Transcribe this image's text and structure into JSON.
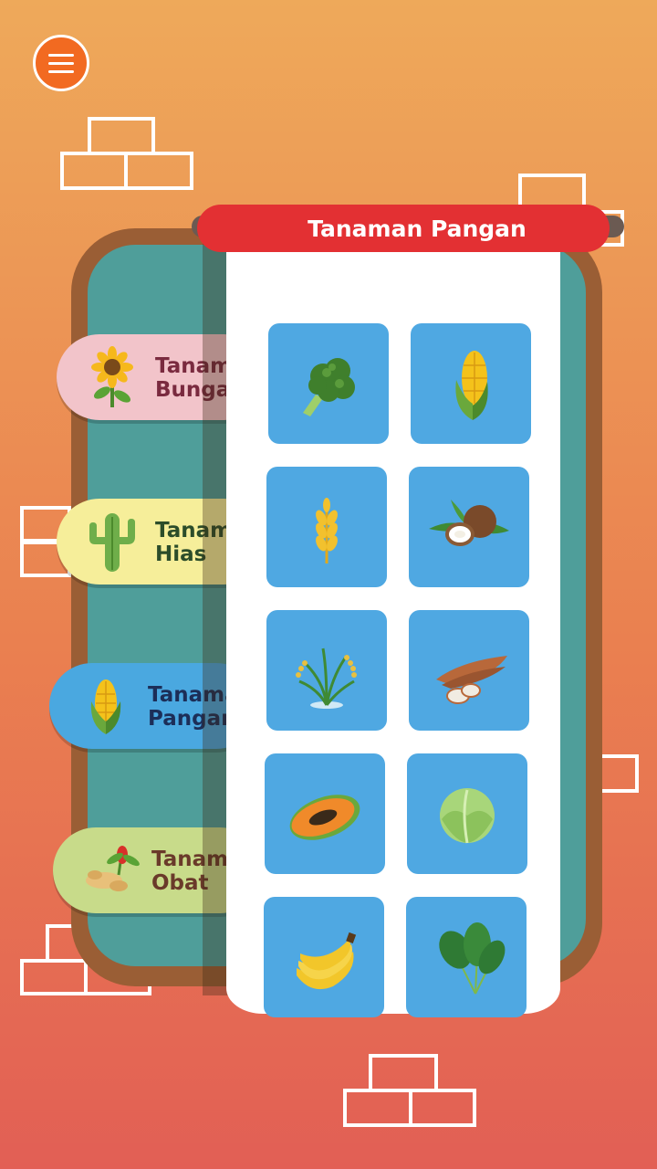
{
  "header": {
    "menu_icon": "hamburger-menu-icon"
  },
  "panel": {
    "title": "Tanaman Pangan"
  },
  "categories": [
    {
      "label": "Tanaman\nBunga",
      "icon": "sunflower-icon"
    },
    {
      "label": "Tanaman\nHias",
      "icon": "cactus-icon"
    },
    {
      "label": "Tanaman\nPangan",
      "icon": "corn-icon"
    },
    {
      "label": "Tanaman\nObat",
      "icon": "ginger-icon"
    }
  ],
  "items": [
    {
      "icon": "broccoli-icon"
    },
    {
      "icon": "corn-icon"
    },
    {
      "icon": "wheat-icon"
    },
    {
      "icon": "coconut-icon"
    },
    {
      "icon": "rice-plant-icon"
    },
    {
      "icon": "cassava-icon"
    },
    {
      "icon": "papaya-icon"
    },
    {
      "icon": "cabbage-icon"
    },
    {
      "icon": "banana-icon"
    },
    {
      "icon": "spinach-icon"
    }
  ],
  "colors": {
    "accent": "#e33033",
    "menu_button": "#f26a21",
    "tile": "#4fa8e2",
    "board": "#4f9e9a"
  }
}
